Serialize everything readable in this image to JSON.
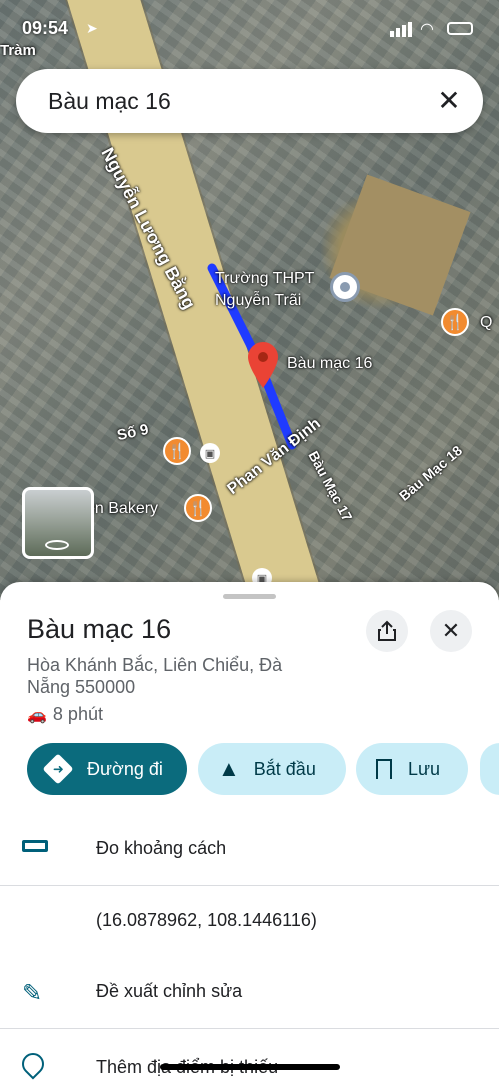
{
  "status_bar": {
    "time": "09:54"
  },
  "map": {
    "street_labels": {
      "nguyen_luong_bang": "Nguyễn Lương Bằng",
      "phan_van_dinh": "Phan Văn Định",
      "bau_mac_17": "Bàu Mạc 17",
      "bau_mac_18": "Bàu Mạc 18",
      "so_9": "Số 9",
      "tram": "Tràm"
    },
    "places": {
      "school": "Trường THPT Nguyễn Trãi",
      "pin_label": "Bàu mạc 16",
      "bakery": "ền Bakery",
      "right_poi": "Q"
    }
  },
  "search": {
    "value": "Bàu mạc 16"
  },
  "sheet": {
    "title": "Bàu mạc 16",
    "address": "Hòa Khánh Bắc, Liên Chiểu, Đà Nẵng 550000",
    "drive_time": "8 phút",
    "actions": {
      "directions": "Đường đi",
      "start": "Bắt đầu",
      "save": "Lưu"
    },
    "rows": {
      "measure": "Đo khoảng cách",
      "coordinates": "(16.0878962, 108.1446116)",
      "suggest_edit": "Đề xuất chỉnh sửa",
      "add_place": "Thêm địa điểm bị thiếu"
    }
  },
  "colors": {
    "primary": "#0b6b7d",
    "chip_bg": "#c9edf7",
    "route": "#1f3bff",
    "pin": "#ea4335"
  }
}
